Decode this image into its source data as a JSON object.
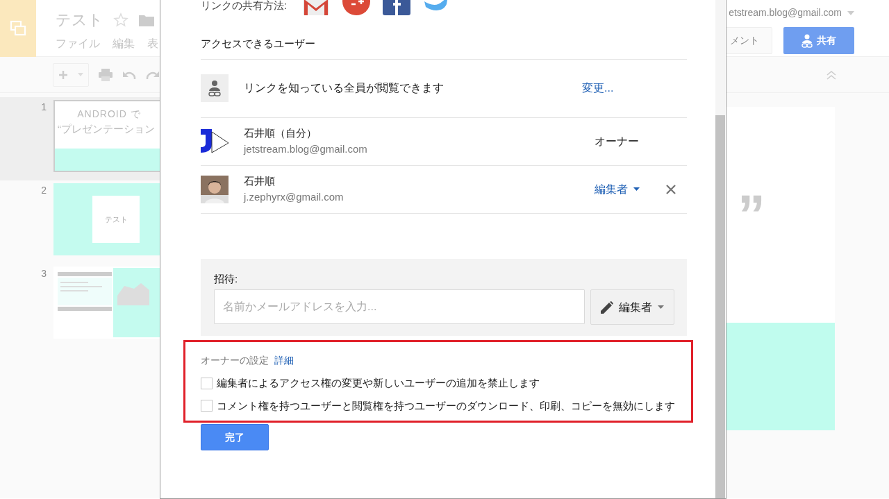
{
  "background": {
    "app_title": "テスト",
    "menu": [
      "ファイル",
      "編集",
      "表"
    ],
    "account": "etstream.blog@gmail.com",
    "comment_button": "メント",
    "share_button": "共有",
    "slides": [
      {
        "number": "1",
        "kind": "title",
        "line1": "ANDROID で",
        "line2": "“プレゼンテーション",
        "selected": true
      },
      {
        "number": "2",
        "kind": "text",
        "line1": "テスト",
        "selected": false
      },
      {
        "number": "3",
        "selected": false
      }
    ],
    "canvas_text": "”"
  },
  "dialog": {
    "share_label": "リンクの共有方法:",
    "access_heading": "アクセスできるユーザー",
    "link_access": {
      "text": "リンクを知っている全員が閲覧できます",
      "change_link": "変更..."
    },
    "users": [
      {
        "kind": "owner",
        "name": "石井順（自分）",
        "email": "jetstream.blog@gmail.com",
        "role": "オーナー"
      },
      {
        "kind": "editor",
        "name": "石井順",
        "email": "j.zephyrx@gmail.com",
        "role": "編集者"
      }
    ],
    "invite": {
      "label": "招待:",
      "placeholder": "名前かメールアドレスを入力...",
      "role_button": "編集者"
    },
    "owner_settings": {
      "label": "オーナーの設定",
      "details_link": "詳細",
      "options": [
        {
          "text": "編集者によるアクセス権の変更や新しいユーザーの追加を禁止します",
          "checked": false
        },
        {
          "text": "コメント権を持つユーザーと閲覧権を持つユーザーのダウンロード、印刷、コピーを無効にします",
          "checked": false
        }
      ]
    },
    "done_button": "完了"
  }
}
